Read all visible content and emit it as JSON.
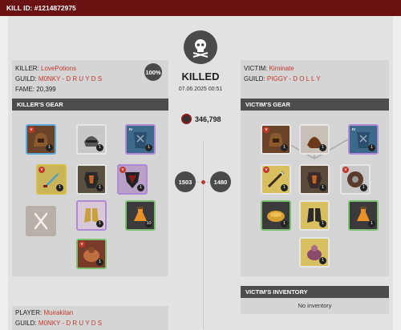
{
  "header": {
    "kill_id": "KILL ID: #1214872975"
  },
  "killer": {
    "killer_label": "KILLER:",
    "killer_name": "LovePotions",
    "guild_label": "GUILD:",
    "guild_name": "M0NKY - D R U Y D S",
    "fame_label": "FAME:",
    "fame_value": "20,399",
    "damage_pct": "100%",
    "gear_title": "KILLER'S GEAR",
    "gear": [
      {
        "slot": "bag",
        "qty": "1"
      },
      {
        "slot": "head",
        "qty": "1"
      },
      {
        "slot": "cape",
        "qty": "1"
      },
      {
        "slot": "mainhand",
        "qty": "1"
      },
      {
        "slot": "armor",
        "qty": "1"
      },
      {
        "slot": "offhand",
        "qty": "1"
      },
      {
        "slot": "food",
        "empty": true
      },
      {
        "slot": "shoes",
        "qty": "1"
      },
      {
        "slot": "potion",
        "qty": "10"
      },
      {
        "slot": "mount",
        "qty": "1"
      }
    ]
  },
  "center": {
    "title": "KILLED",
    "date": "07.06.2025 00:51",
    "fame_total": "346,798",
    "killer_ip": "1503",
    "victim_ip": "1480"
  },
  "victim": {
    "victim_label": "VICTIM:",
    "victim_name": "Kiminate",
    "guild_label": "GUILD:",
    "guild_name": "PIGGY - D O L L Y",
    "gear_title": "VICTIM'S GEAR",
    "gear": [
      {
        "slot": "bag",
        "qty": "1"
      },
      {
        "slot": "head",
        "qty": "1"
      },
      {
        "slot": "cape",
        "qty": "1"
      },
      {
        "slot": "mainhand",
        "qty": "1"
      },
      {
        "slot": "armor",
        "qty": "1"
      },
      {
        "slot": "offhand",
        "qty": "1"
      },
      {
        "slot": "food",
        "qty": "1"
      },
      {
        "slot": "shoes",
        "qty": "1"
      },
      {
        "slot": "potion",
        "qty": "1"
      },
      {
        "slot": "mount",
        "qty": "1"
      }
    ],
    "inventory_title": "VICTIM'S INVENTORY",
    "inventory_empty": "No inventory"
  },
  "participant": {
    "player_label": "PLAYER:",
    "player_name": "Muirakitan",
    "guild_label": "GUILD:",
    "guild_name": "M0NKY - D R U Y D S"
  }
}
